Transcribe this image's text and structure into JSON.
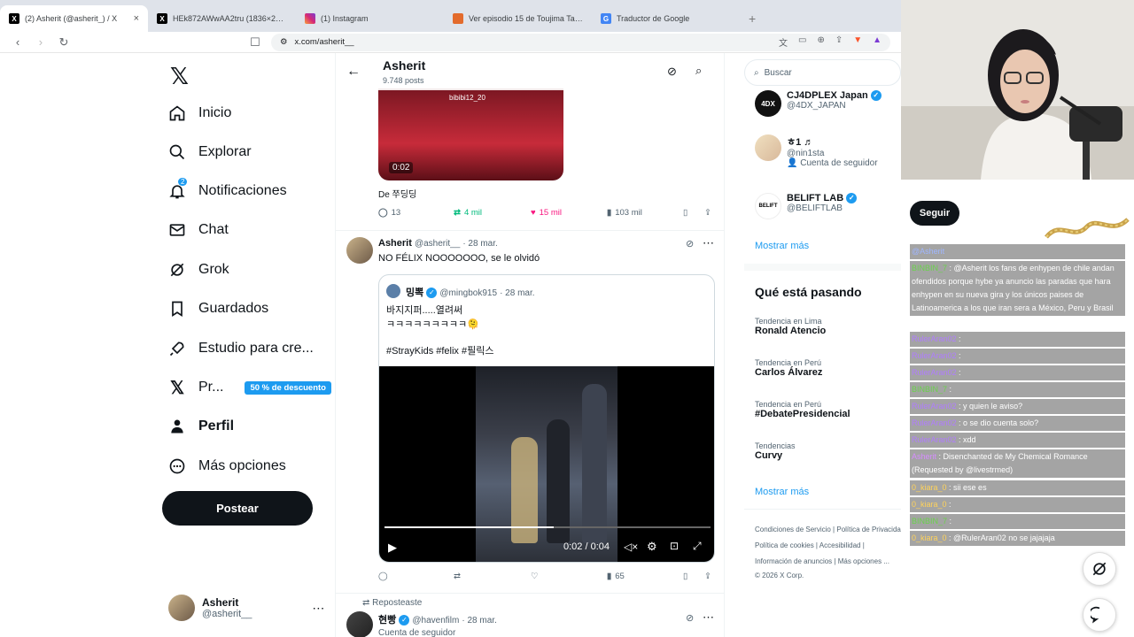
{
  "browser": {
    "tabs": [
      {
        "title": "(2) Asherit (@asherit_) / X",
        "icon": "x-logo-icon",
        "active": true
      },
      {
        "title": "HEk872AWwAA2tru (1836×2048)",
        "icon": "x-logo-icon",
        "active": false
      },
      {
        "title": "(1) Instagram",
        "icon": "instagram-icon",
        "active": false
      },
      {
        "title": "Ver episodio 15 de Toujima Tanzaburo",
        "icon": "anime-site-icon",
        "active": false
      },
      {
        "title": "Traductor de Google",
        "icon": "google-translate-icon",
        "active": false
      }
    ],
    "url": "x.com/asherit__"
  },
  "sidebar": {
    "items": [
      {
        "label": "Inicio",
        "icon": "home-icon"
      },
      {
        "label": "Explorar",
        "icon": "search-icon"
      },
      {
        "label": "Notificaciones",
        "icon": "bell-icon",
        "badge": "2"
      },
      {
        "label": "Chat",
        "icon": "mail-icon"
      },
      {
        "label": "Grok",
        "icon": "grok-icon"
      },
      {
        "label": "Guardados",
        "icon": "bookmark-icon"
      },
      {
        "label": "Estudio para cre...",
        "icon": "rocket-icon"
      },
      {
        "label": "Pr...",
        "icon": "x-logo-icon",
        "promo": "50 % de descuento"
      },
      {
        "label": "Perfil",
        "icon": "person-icon"
      },
      {
        "label": "Más opciones",
        "icon": "more-circle-icon"
      }
    ],
    "post_button": "Postear",
    "account": {
      "name": "Asherit",
      "handle": "@asherit__"
    }
  },
  "profile_header": {
    "name": "Asherit",
    "posts": "9.748 posts"
  },
  "feed": {
    "first_post": {
      "video_watermark": "bibibi12_20",
      "video_time": "0:02",
      "from": "De 쭈딩딩",
      "replies": "13",
      "reposts": "4 mil",
      "likes": "15 mil",
      "views": "103 mil"
    },
    "second_post": {
      "author": "Asherit",
      "handle": "@asherit__",
      "date": "· 28 mar.",
      "text": "NO FÉLIX NOOOOOOO, se le olvidó",
      "quote": {
        "author": "밍뽁",
        "handle": "@mingbok915",
        "date": "· 28 mar.",
        "line1": "바지지퍼.....열려써",
        "line2": "ㅋㅋㅋㅋㅋㅋㅋㅋㅋ🫠",
        "line3": "#StrayKids #felix #필릭스",
        "video_time": "0:02 / 0:04"
      },
      "views": "65"
    },
    "repost_label": "Reposteaste",
    "third_post": {
      "author": "현빵",
      "handle": "@havenfilm",
      "date": "· 28 mar.",
      "sub": "Cuenta de seguidor"
    }
  },
  "right": {
    "search_placeholder": "Buscar",
    "suggestions": [
      {
        "name": "CJ4DPLEX Japan",
        "handle": "@4DX_JAPAN",
        "verified": true,
        "note": "",
        "logo": "4DX"
      },
      {
        "name": "ㅎ1 ♬",
        "handle": "@nin1sta",
        "verified": false,
        "note": "Cuenta de seguidor",
        "logo": ""
      },
      {
        "name": "BELIFT LAB",
        "handle": "@BELIFTLAB",
        "verified": true,
        "note": "",
        "logo": "BELIFT"
      }
    ],
    "show_more": "Mostrar más",
    "follow": "Seguir",
    "trends_title": "Qué está pasando",
    "trends": [
      {
        "context": "Tendencia en Lima",
        "name": "Ronald Atencio"
      },
      {
        "context": "Tendencia en Perú",
        "name": "Carlos Álvarez"
      },
      {
        "context": "Tendencia en Perú",
        "name": "#DebatePresidencial"
      },
      {
        "context": "Tendencias",
        "name": "Curvy"
      }
    ],
    "footer": [
      "Condiciones de Servicio",
      "Política de Privacidad",
      "Política de cookies",
      "Accesibilidad",
      "Información de anuncios",
      "Más opciones ...",
      "© 2026 X Corp."
    ]
  },
  "stream_chat": [
    {
      "user": "@Asherit",
      "text": ""
    },
    {
      "user": "BINBIN_7",
      "text": ": @Asherit los fans de enhypen de chile andan ofendidos porque hybe ya anuncio las paradas que hara enhypen en su nueva gira y los únicos paises de Latinoamerica a los que iran sera a México, Peru y Brasil"
    },
    {
      "user": "RulerAran02",
      "text": ":"
    },
    {
      "user": "RulerAran02",
      "text": ":"
    },
    {
      "user": "RulerAran02",
      "text": ":"
    },
    {
      "user": "BINBIN_7",
      "text": ":"
    },
    {
      "user": "RulerAran02",
      "text": ": y quien le aviso?"
    },
    {
      "user": "RulerAran02",
      "text": ": o se dio cuenta solo?"
    },
    {
      "user": "RulerAran02",
      "text": ": xdd"
    },
    {
      "user": "Asherit",
      "text": ": Disenchanted de My Chemical Romance (Requested by @livestrmed)"
    },
    {
      "user": "0_kiara_0",
      "text": ": sii ese es"
    },
    {
      "user": "0_kiara_0",
      "text": ":"
    },
    {
      "user": "BINBIN_7",
      "text": ":"
    },
    {
      "user": "0_kiara_0",
      "text": ": @RulerAran02 no se jajajaja"
    }
  ],
  "colors": {
    "accent": "#1d9bf0",
    "like": "#f91880",
    "repost": "#00ba7c",
    "dark": "#0f1419"
  }
}
